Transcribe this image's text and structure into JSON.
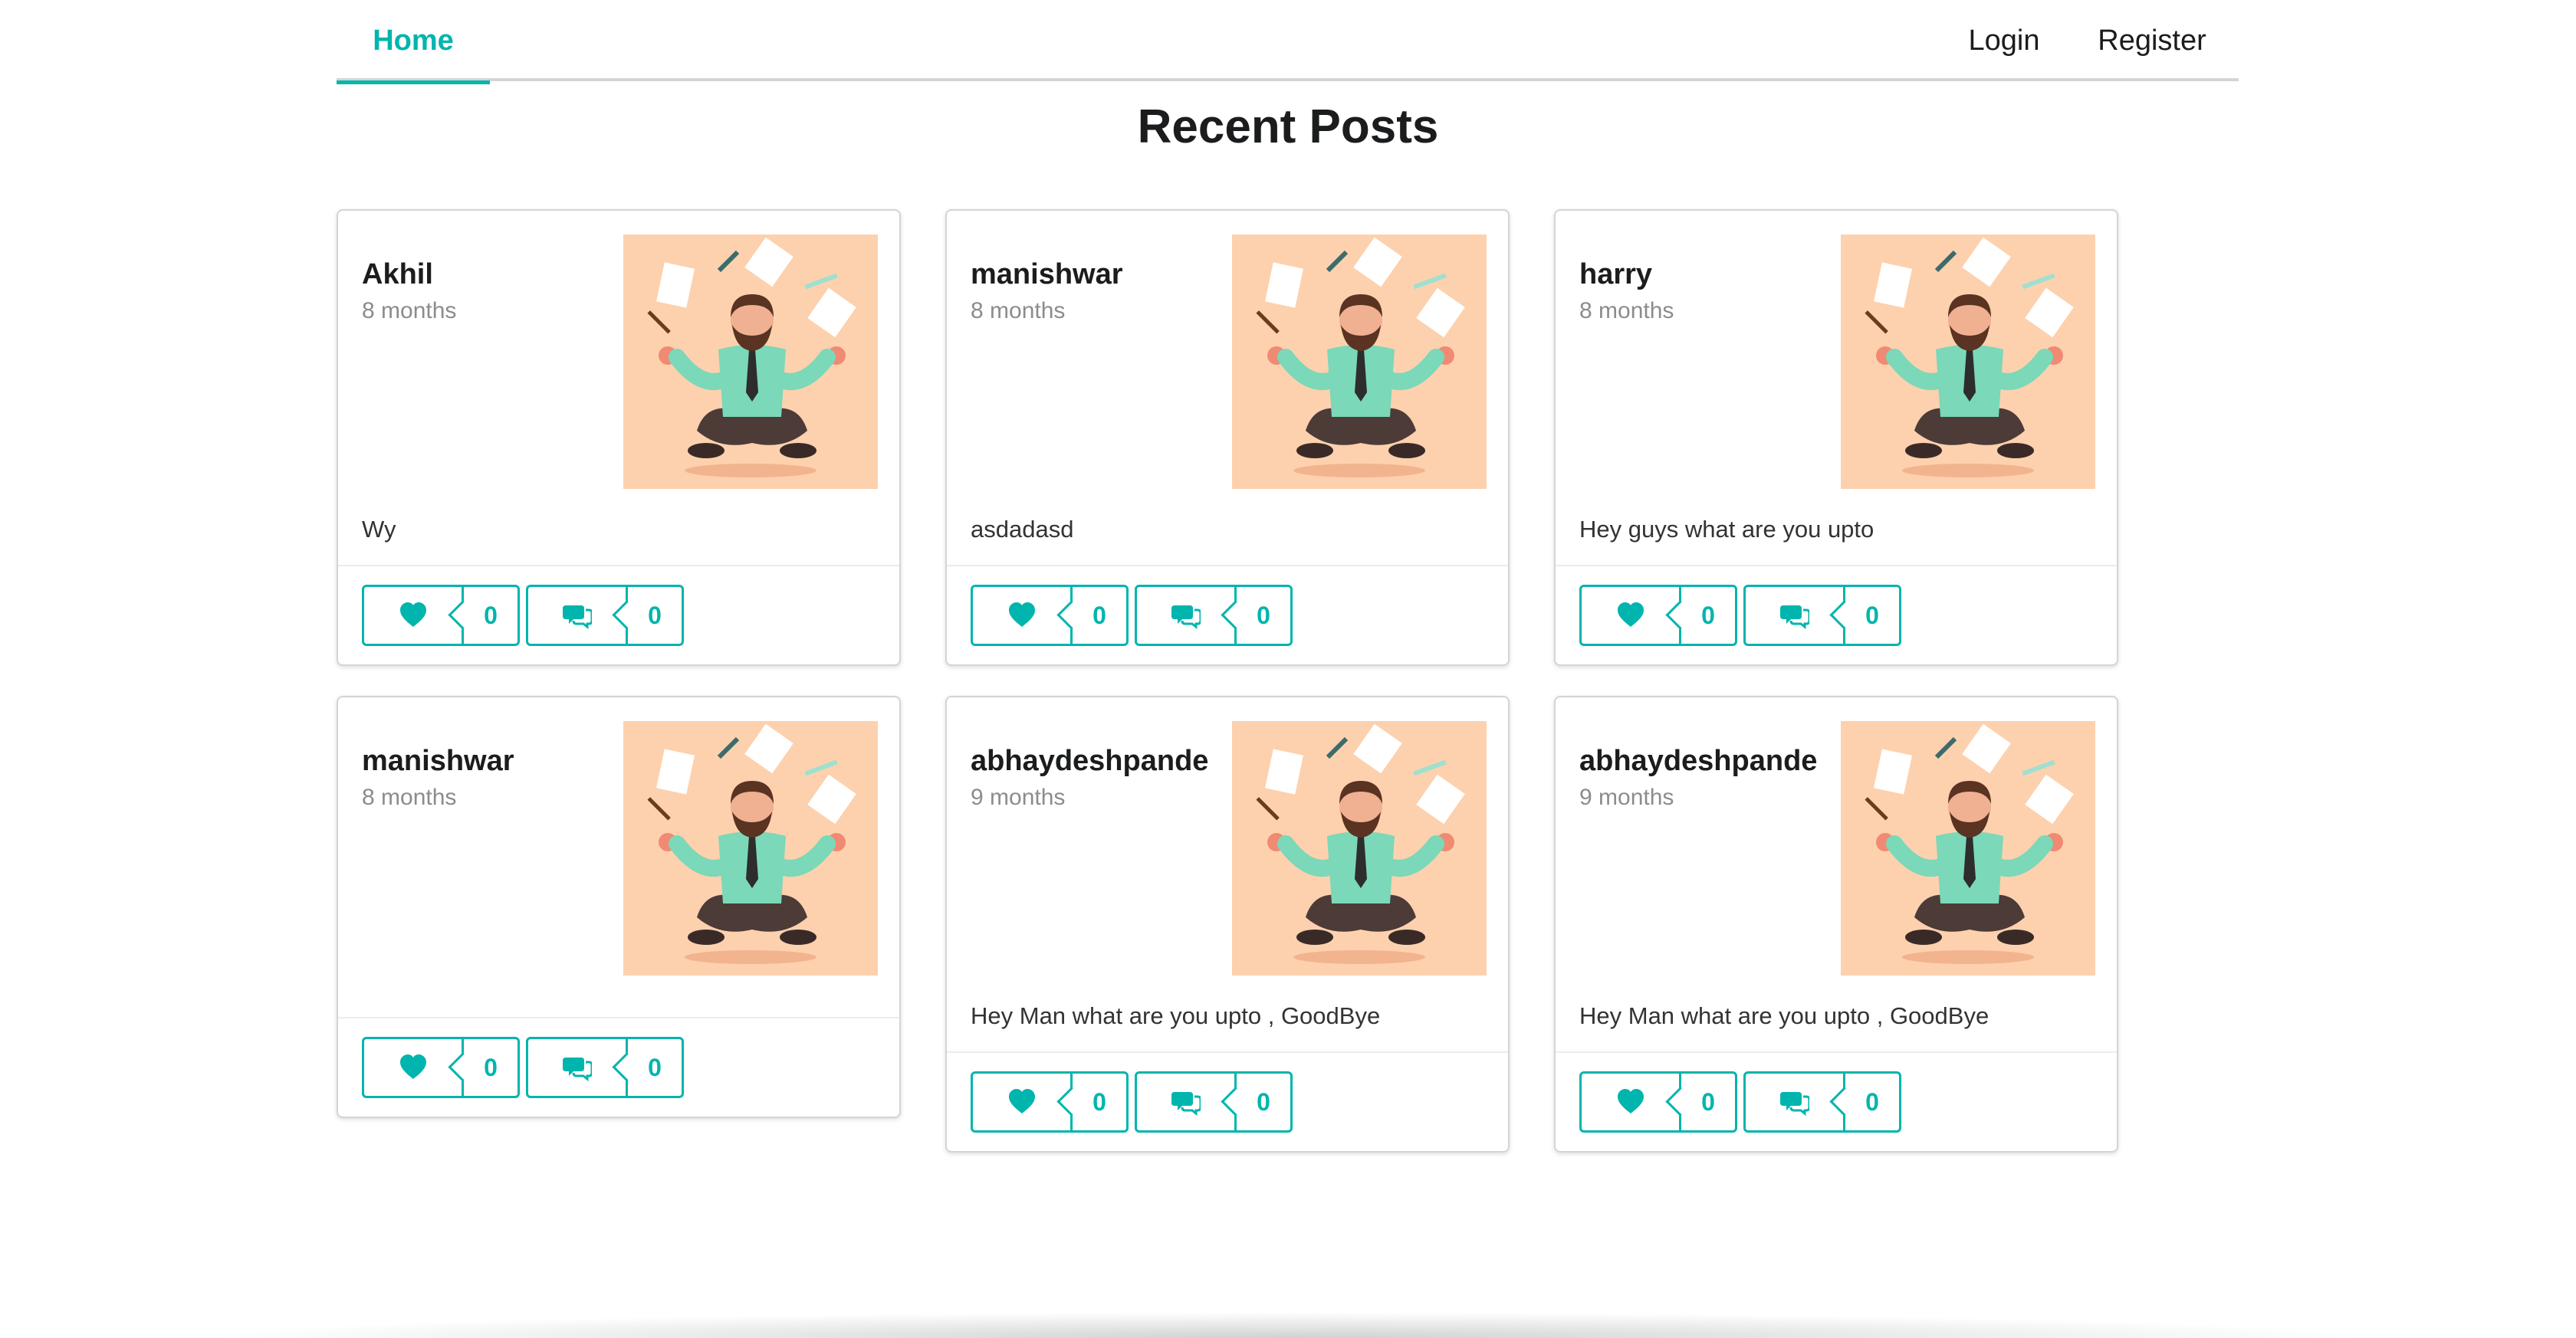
{
  "nav": {
    "home": "Home",
    "login": "Login",
    "register": "Register",
    "accent_color": "#00b5ad"
  },
  "page": {
    "title": "Recent Posts"
  },
  "posts": [
    {
      "author": "Akhil",
      "time": "8 months",
      "body": "Wy",
      "likes": "0",
      "comments": "0",
      "image_icon": "meditating-man-illustration"
    },
    {
      "author": "manishwar",
      "time": "8 months",
      "body": "asdadasd",
      "likes": "0",
      "comments": "0",
      "image_icon": "meditating-man-illustration"
    },
    {
      "author": "harry",
      "time": "8 months",
      "body": "Hey guys what are you upto",
      "likes": "0",
      "comments": "0",
      "image_icon": "meditating-man-illustration"
    },
    {
      "author": "manishwar",
      "time": "8 months",
      "body": "",
      "likes": "0",
      "comments": "0",
      "image_icon": "meditating-man-illustration"
    },
    {
      "author": "abhaydeshpande",
      "time": "9 months",
      "body": "Hey Man what are you upto , GoodBye",
      "likes": "0",
      "comments": "0",
      "image_icon": "meditating-man-illustration"
    },
    {
      "author": "abhaydeshpande",
      "time": "9 months",
      "body": "Hey Man what are you upto , GoodBye",
      "likes": "0",
      "comments": "0",
      "image_icon": "meditating-man-illustration"
    }
  ],
  "icons": {
    "like": "heart-icon",
    "comment": "comments-icon"
  }
}
